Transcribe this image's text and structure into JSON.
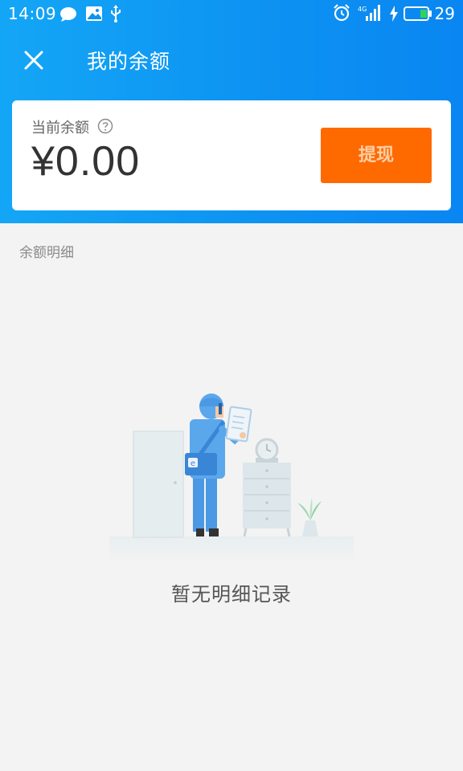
{
  "status_bar": {
    "time": "14:09",
    "battery": "29",
    "network": "4G"
  },
  "header": {
    "title": "我的余额"
  },
  "balance_card": {
    "label": "当前余额",
    "amount": "¥0.00",
    "withdraw_label": "提现"
  },
  "details": {
    "section_label": "余额明细",
    "empty_text": "暂无明细记录"
  },
  "colors": {
    "header_blue": "#0d93f2",
    "withdraw_orange": "#ff6a00"
  }
}
